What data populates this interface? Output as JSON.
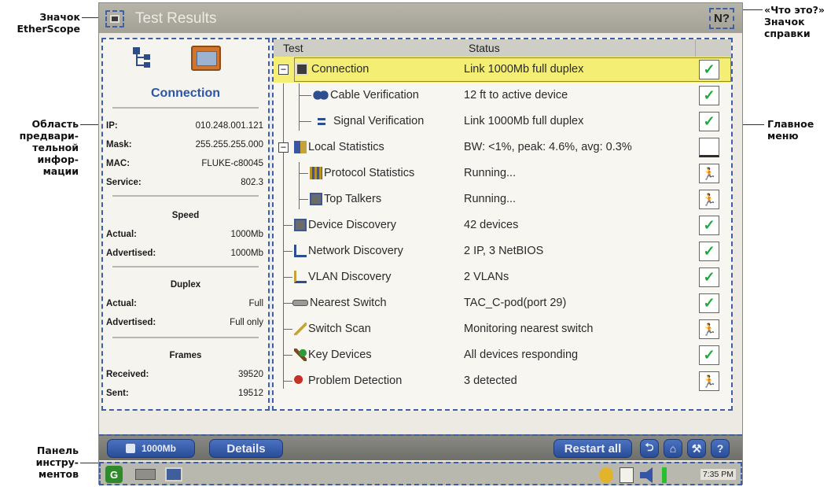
{
  "callouts": {
    "ether_icon": [
      "Значок",
      "EtherScope"
    ],
    "help_icon": [
      "«Что это?»",
      "Значок",
      "справки"
    ],
    "preview_area": [
      "Область",
      "предвари-",
      "тельной",
      "инфор-",
      "мации"
    ],
    "main_menu": [
      "Главное",
      "меню"
    ],
    "toolbar": [
      "Панель",
      "инстру-",
      "ментов"
    ]
  },
  "window": {
    "title": "Test Results",
    "help_glyph": "N?"
  },
  "preview": {
    "title": "Connection",
    "info": [
      {
        "key": "IP:",
        "value": "010.248.001.121"
      },
      {
        "key": "Mask:",
        "value": "255.255.255.000"
      },
      {
        "key": "MAC:",
        "value": "FLUKE-c80045"
      },
      {
        "key": "Service:",
        "value": "802.3"
      }
    ],
    "speed": {
      "heading": "Speed",
      "actual_key": "Actual:",
      "actual": "1000Mb",
      "advertised_key": "Advertised:",
      "advertised": "1000Mb"
    },
    "duplex": {
      "heading": "Duplex",
      "actual_key": "Actual:",
      "actual": "Full",
      "advertised_key": "Advertised:",
      "advertised": "Full only"
    },
    "frames": {
      "heading": "Frames",
      "received_key": "Received:",
      "received": "39520",
      "sent_key": "Sent:",
      "sent": "19512"
    }
  },
  "table": {
    "headers": {
      "test": "Test",
      "status": "Status"
    },
    "rows": [
      {
        "name": "Connection",
        "status": "Link 1000Mb full duplex",
        "result": "✓",
        "icon": "connection-icon"
      },
      {
        "name": "Cable Verification",
        "status": "12 ft to active device",
        "result": "✓",
        "icon": "cable-icon"
      },
      {
        "name": "Signal Verification",
        "status": "Link 1000Mb full duplex",
        "result": "✓",
        "icon": "signal-icon"
      },
      {
        "name": "Local Statistics",
        "status": "BW: <1%, peak: 4.6%, avg: 0.3%",
        "result": "",
        "icon": "statistics-icon"
      },
      {
        "name": "Protocol Statistics",
        "status": "Running...",
        "result": "🏃",
        "icon": "protocol-icon"
      },
      {
        "name": "Top Talkers",
        "status": "Running...",
        "result": "🏃",
        "icon": "top-talkers-icon"
      },
      {
        "name": "Device Discovery",
        "status": "42 devices",
        "result": "✓",
        "icon": "device-icon"
      },
      {
        "name": "Network Discovery",
        "status": "2 IP, 3 NetBIOS",
        "result": "✓",
        "icon": "network-icon"
      },
      {
        "name": "VLAN Discovery",
        "status": "2 VLANs",
        "result": "✓",
        "icon": "vlan-icon"
      },
      {
        "name": "Nearest Switch",
        "status": "TAC_C-pod(port 29)",
        "result": "✓",
        "icon": "switch-icon"
      },
      {
        "name": "Switch Scan",
        "status": "Monitoring nearest switch",
        "result": "🏃",
        "icon": "switch-scan-icon"
      },
      {
        "name": "Key Devices",
        "status": "All devices responding",
        "result": "✓",
        "icon": "key-devices-icon"
      },
      {
        "name": "Problem Detection",
        "status": "3 detected",
        "result": "🏃",
        "icon": "problem-icon"
      }
    ]
  },
  "toolbar": {
    "speed_label": "1000Mb",
    "details_label": "Details",
    "restart_label": "Restart all",
    "back_glyph": "⮌",
    "home_glyph": "⌂",
    "tools_glyph": "⚒",
    "help_glyph": "?"
  },
  "taskbar": {
    "clock": "7:35 PM"
  },
  "colors": {
    "accent": "#3d5ea8",
    "selection": "#f4ee74",
    "pass": "#1ea73a",
    "titlebar": "#a8a69a"
  }
}
